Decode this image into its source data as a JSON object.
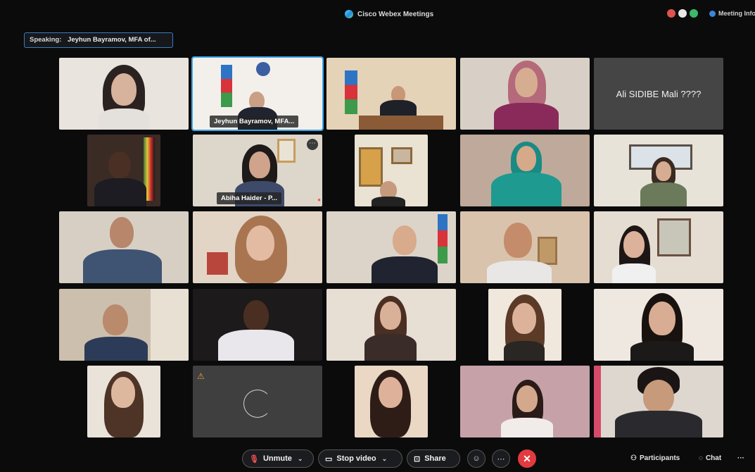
{
  "window": {
    "app_title": "Cisco Webex Meetings",
    "meeting_info_label": "Meeting Info"
  },
  "speaking": {
    "label": "Speaking:",
    "name": "Jeyhun Bayramov, MFA of..."
  },
  "tiles": {
    "t2_name": "Jeyhun Bayramov, MFA...",
    "t5_name": "Ali SIDIBE Mali ????",
    "t7_name": "Abiha Haider - P..."
  },
  "toolbar": {
    "unmute_label": "Unmute",
    "stop_video_label": "Stop video",
    "share_label": "Share",
    "participants_label": "Participants",
    "chat_label": "Chat",
    "more_label": "···"
  },
  "colors": {
    "accent": "#3ba7e8",
    "end_call": "#e23a3f",
    "muted": "#f05252"
  }
}
